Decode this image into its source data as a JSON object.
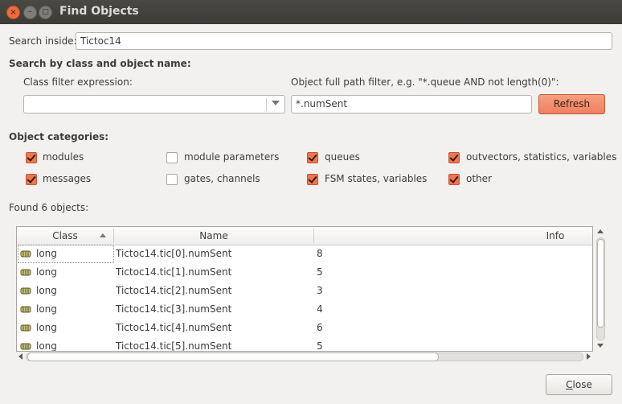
{
  "window": {
    "title": "Find Objects",
    "close_glyph": "×",
    "minimize_glyph": "–",
    "maximize_glyph": "□"
  },
  "search_inside": {
    "label": "Search inside:",
    "value": "Tictoc14"
  },
  "search_section_title": "Search by class and object name:",
  "class_filter": {
    "label": "Class filter expression:",
    "value": ""
  },
  "path_filter": {
    "label": "Object full path filter, e.g. \"*.queue AND not length(0)\":",
    "value": "*.numSent"
  },
  "refresh_label": "Refresh",
  "categories": {
    "title": "Object categories:",
    "items": [
      {
        "label": "modules",
        "checked": true
      },
      {
        "label": "messages",
        "checked": true
      },
      {
        "label": "module parameters",
        "checked": false
      },
      {
        "label": "gates, channels",
        "checked": false
      },
      {
        "label": "queues",
        "checked": true
      },
      {
        "label": "FSM states, variables",
        "checked": true
      },
      {
        "label": "outvectors, statistics, variables",
        "checked": true
      },
      {
        "label": "other",
        "checked": true
      }
    ]
  },
  "found_label": "Found 6 objects:",
  "table": {
    "columns": [
      "Class",
      "Name",
      "Info"
    ],
    "sort_column": "Class",
    "rows": [
      {
        "class": "long",
        "name": "Tictoc14.tic[0].numSent",
        "info": "8"
      },
      {
        "class": "long",
        "name": "Tictoc14.tic[1].numSent",
        "info": "5"
      },
      {
        "class": "long",
        "name": "Tictoc14.tic[2].numSent",
        "info": "3"
      },
      {
        "class": "long",
        "name": "Tictoc14.tic[3].numSent",
        "info": "4"
      },
      {
        "class": "long",
        "name": "Tictoc14.tic[4].numSent",
        "info": "6"
      },
      {
        "class": "long",
        "name": "Tictoc14.tic[5].numSent",
        "info": "5"
      }
    ]
  },
  "close_label_prefix": "",
  "close_label_mnemonic": "C",
  "close_label_rest": "lose",
  "colors": {
    "accent": "#ee7650",
    "titlebar": "#3c3b37",
    "background": "#f2f1f0"
  },
  "icons": {
    "object": "object-icon",
    "combo": "chevron-down-icon",
    "check": "check-icon"
  }
}
